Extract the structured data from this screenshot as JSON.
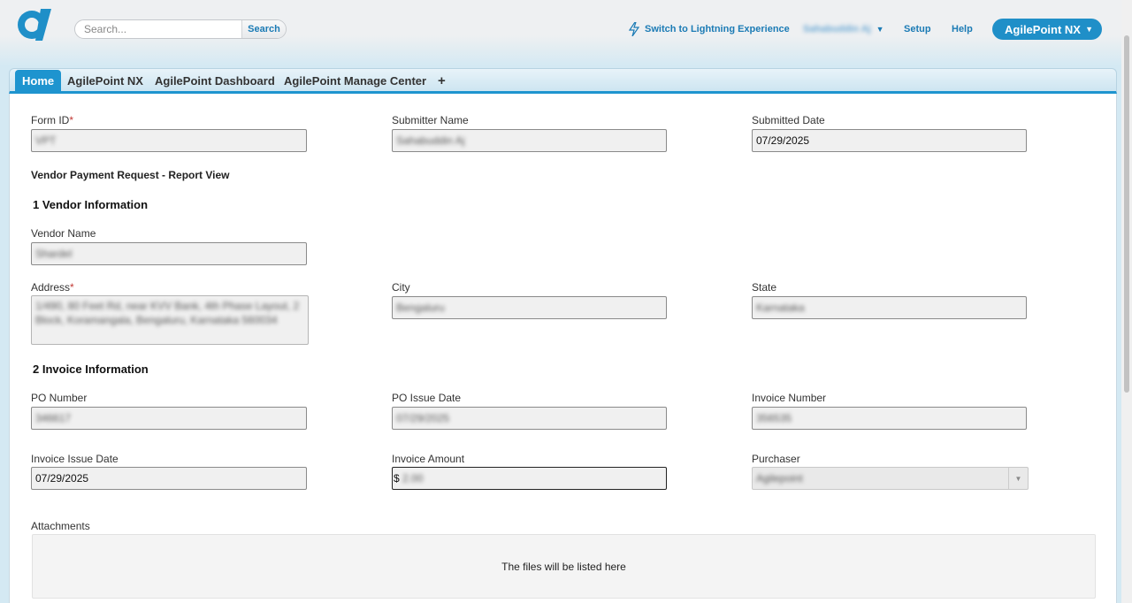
{
  "header": {
    "search_placeholder": "Search...",
    "search_button": "Search",
    "lightning_link": "Switch to Lightning Experience",
    "user_name": "Sahabuddin Aj",
    "setup_link": "Setup",
    "help_link": "Help",
    "app_menu": "AgilePoint NX"
  },
  "tabs": [
    {
      "label": "Home"
    },
    {
      "label": "AgilePoint NX"
    },
    {
      "label": "AgilePoint Dashboard"
    },
    {
      "label": "AgilePoint Manage Center"
    },
    {
      "label": "+"
    }
  ],
  "form": {
    "form_id_label": "Form ID",
    "form_id_value": "VPT",
    "submitter_label": "Submitter Name",
    "submitter_value": "Sahabuddin Aj",
    "submitted_date_label": "Submitted Date",
    "submitted_date_value": "07/29/2025",
    "report_title": "Vendor Payment Request - Report View",
    "section1": "1 Vendor Information",
    "vendor_name_label": "Vendor Name",
    "vendor_name_value": "Shardel",
    "address_label": "Address",
    "address_value": "1/490, 80 Feet Rd, near KVV Bank, 4th Phase Layout, 2 Block, Koramangala, Bengaluru, Karnataka 560034",
    "city_label": "City",
    "city_value": "Bengaluru",
    "state_label": "State",
    "state_value": "Karnataka",
    "section2": "2 Invoice Information",
    "po_number_label": "PO Number",
    "po_number_value": "346617",
    "po_issue_label": "PO Issue Date",
    "po_issue_value": "07/29/2025",
    "invoice_number_label": "Invoice Number",
    "invoice_number_value": "356535",
    "invoice_issue_label": "Invoice Issue Date",
    "invoice_issue_value": "07/29/2025",
    "invoice_amount_label": "Invoice Amount",
    "invoice_amount_currency": "$",
    "invoice_amount_value": "2.00",
    "purchaser_label": "Purchaser",
    "purchaser_value": "Agilepoint",
    "attachments_label": "Attachments",
    "attachments_placeholder": "The files will be listed here"
  }
}
